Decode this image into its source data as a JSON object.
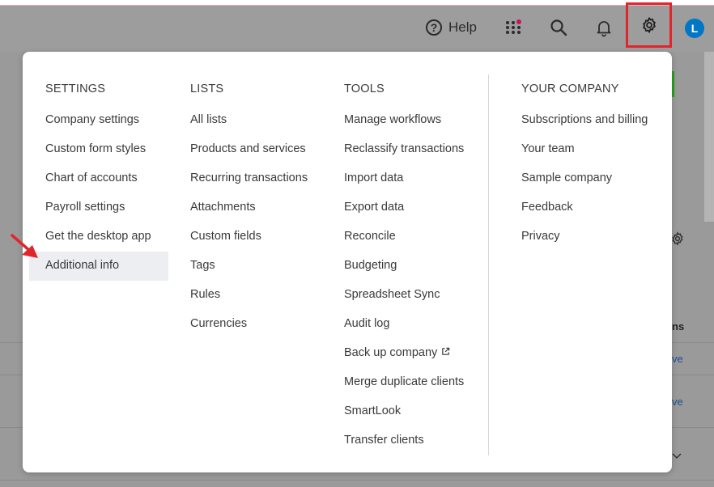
{
  "topbar": {
    "help_label": "Help",
    "help_icon": "question-circle-icon",
    "apps_icon": "apps-grid-icon",
    "search_icon": "search-icon",
    "bell_icon": "bell-icon",
    "gear_icon": "gear-icon",
    "avatar_initial": "L",
    "accent_color": "#0077c5",
    "gear_highlight_color": "#e0262d"
  },
  "background": {
    "column_fragment": "ns",
    "link_fragment_1": "ve",
    "link_fragment_2": "ve"
  },
  "menu": {
    "columns": [
      {
        "heading": "SETTINGS",
        "items": [
          {
            "label": "Company settings"
          },
          {
            "label": "Custom form styles"
          },
          {
            "label": "Chart of accounts"
          },
          {
            "label": "Payroll settings"
          },
          {
            "label": "Get the desktop app"
          },
          {
            "label": "Additional info"
          }
        ]
      },
      {
        "heading": "LISTS",
        "items": [
          {
            "label": "All lists"
          },
          {
            "label": "Products and services"
          },
          {
            "label": "Recurring transactions"
          },
          {
            "label": "Attachments"
          },
          {
            "label": "Custom fields"
          },
          {
            "label": "Tags"
          },
          {
            "label": "Rules"
          },
          {
            "label": "Currencies"
          }
        ]
      },
      {
        "heading": "TOOLS",
        "items": [
          {
            "label": "Manage workflows"
          },
          {
            "label": "Reclassify transactions"
          },
          {
            "label": "Import data"
          },
          {
            "label": "Export data"
          },
          {
            "label": "Reconcile"
          },
          {
            "label": "Budgeting"
          },
          {
            "label": "Spreadsheet Sync"
          },
          {
            "label": "Audit log"
          },
          {
            "label": "Back up company"
          },
          {
            "label": "Merge duplicate clients"
          },
          {
            "label": "SmartLook"
          },
          {
            "label": "Transfer clients"
          }
        ]
      },
      {
        "heading": "YOUR COMPANY",
        "items": [
          {
            "label": "Subscriptions and billing"
          },
          {
            "label": "Your team"
          },
          {
            "label": "Sample company"
          },
          {
            "label": "Feedback"
          },
          {
            "label": "Privacy"
          }
        ]
      }
    ],
    "highlighted_item": "Additional info",
    "external_link_icon": "external-link-icon",
    "annotation_arrow_color": "#e0262d"
  }
}
